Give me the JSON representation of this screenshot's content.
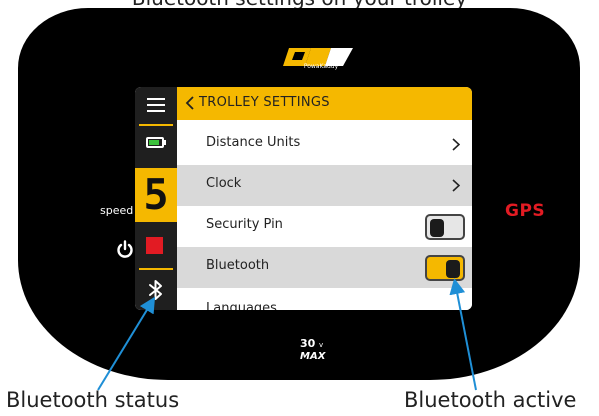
{
  "caption_top": "Bluetooth settings on your trolley",
  "brand": {
    "sub": "PowaKaddy",
    "mark": "PK"
  },
  "device": {
    "speed_label": "speed",
    "gps_label": "GPS",
    "model_label": "30v MAX"
  },
  "status": {
    "speed_setting": "5",
    "battery_level": 0.85
  },
  "screen": {
    "header": "TROLLEY SETTINGS",
    "rows": [
      {
        "label": "Distance Units",
        "control": "chevron"
      },
      {
        "label": "Clock",
        "control": "chevron"
      },
      {
        "label": "Security Pin",
        "control": "toggle",
        "state": "off"
      },
      {
        "label": "Bluetooth",
        "control": "toggle",
        "state": "on"
      },
      {
        "label": "Languages",
        "control": "none"
      }
    ]
  },
  "callouts": {
    "left": "Bluetooth status",
    "right": "Bluetooth active"
  },
  "colors": {
    "accent": "#f5b800",
    "gps": "#e21b23",
    "battery": "#3cc13c",
    "arrow": "#1f8fd6"
  }
}
